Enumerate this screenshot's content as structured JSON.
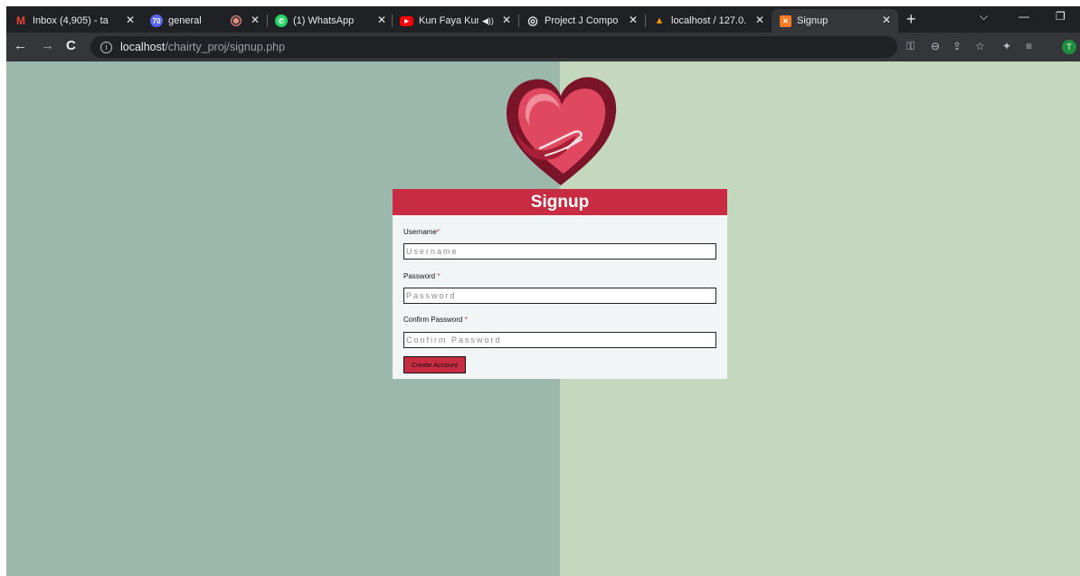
{
  "browser": {
    "tabs": [
      {
        "title": "Inbox (4,905) - ta",
        "icon": "gmail-icon",
        "icon_glyph": "M",
        "icon_color": "#ea4335"
      },
      {
        "title": "general",
        "icon": "notification-badge-icon",
        "icon_glyph": "70",
        "icon_color": "#5865f2"
      },
      {
        "title": "",
        "icon": "recording-icon",
        "icon_glyph": "",
        "icon_color": "#f28b82"
      },
      {
        "title": "(1) WhatsApp",
        "icon": "whatsapp-icon",
        "icon_glyph": "✆",
        "icon_color": "#25d366"
      },
      {
        "title": "Kun Faya Kun",
        "icon": "youtube-icon",
        "icon_glyph": "▶",
        "icon_color": "#ff0000"
      },
      {
        "title": "Project J Compo",
        "icon": "globe-icon",
        "icon_glyph": "◎",
        "icon_color": "#5f6368"
      },
      {
        "title": "localhost / 127.0.",
        "icon": "phpmyadmin-icon",
        "icon_glyph": "▲",
        "icon_color": "#f29111"
      },
      {
        "title": "Signup",
        "icon": "xampp-icon",
        "icon_glyph": "✕",
        "icon_color": "#fb7a24"
      }
    ],
    "url": {
      "host": "localhost",
      "path": "/chairty_proj/signup.php"
    },
    "profile_initial": "T"
  },
  "signup": {
    "title": "Signup",
    "fields": [
      {
        "label": "Username",
        "required_mark": "*",
        "placeholder": "Username"
      },
      {
        "label": "Password ",
        "required_mark": "*",
        "placeholder": "Password"
      },
      {
        "label": "Confirm Password ",
        "required_mark": "*",
        "placeholder": "Confirm Password"
      }
    ],
    "submit_label": "Create Account"
  },
  "colors": {
    "bg_left": "#9cb7ac",
    "bg_right": "#c4d8bd",
    "accent": "#c82c42",
    "card_bg": "#f1f5f5"
  }
}
